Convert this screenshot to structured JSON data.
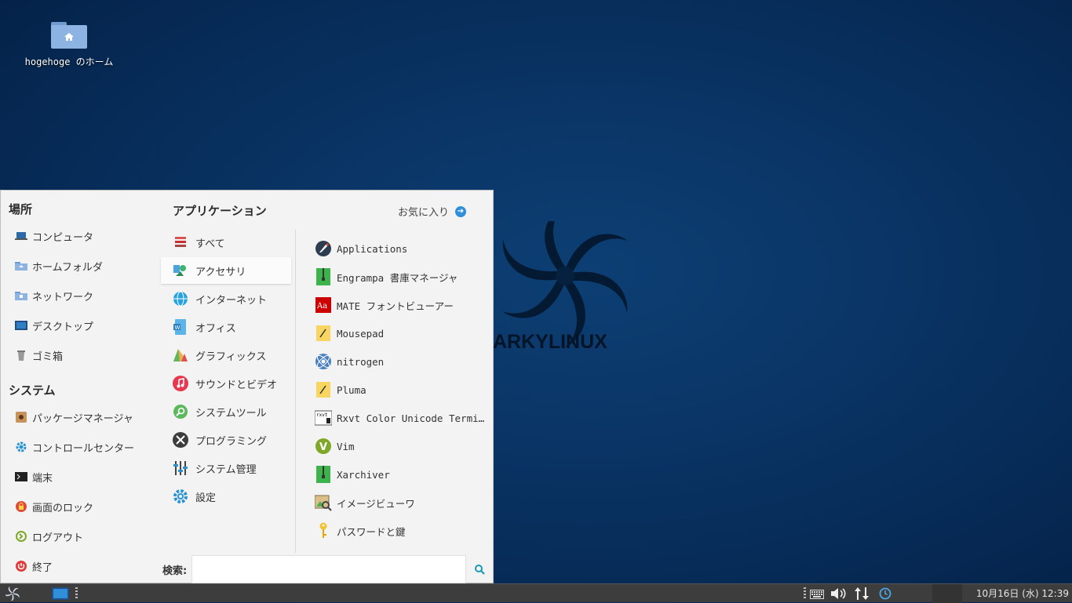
{
  "desktop": {
    "home_icon_label": "hogehoge のホーム",
    "logo_text": "ARKYLINUX"
  },
  "menu": {
    "places_title": "場所",
    "places": [
      {
        "label": "コンピュータ",
        "icon": "computer-icon"
      },
      {
        "label": "ホームフォルダ",
        "icon": "home-folder-icon"
      },
      {
        "label": "ネットワーク",
        "icon": "network-folder-icon"
      },
      {
        "label": "デスクトップ",
        "icon": "desktop-icon"
      },
      {
        "label": "ゴミ箱",
        "icon": "trash-icon"
      }
    ],
    "system_title": "システム",
    "system": [
      {
        "label": "パッケージマネージャ",
        "icon": "package-icon"
      },
      {
        "label": "コントロールセンター",
        "icon": "gear-icon"
      },
      {
        "label": "端末",
        "icon": "terminal-icon"
      },
      {
        "label": "画面のロック",
        "icon": "lock-icon"
      },
      {
        "label": "ログアウト",
        "icon": "logout-icon"
      },
      {
        "label": "終了",
        "icon": "power-icon"
      }
    ],
    "apps_title": "アプリケーション",
    "favorites_label": "お気に入り",
    "categories": [
      {
        "label": "すべて",
        "icon": "all-icon"
      },
      {
        "label": "アクセサリ",
        "icon": "accessories-icon"
      },
      {
        "label": "インターネット",
        "icon": "internet-icon"
      },
      {
        "label": "オフィス",
        "icon": "office-icon"
      },
      {
        "label": "グラフィックス",
        "icon": "graphics-icon"
      },
      {
        "label": "サウンドとビデオ",
        "icon": "music-icon"
      },
      {
        "label": "システムツール",
        "icon": "system-tools-icon"
      },
      {
        "label": "プログラミング",
        "icon": "programming-icon"
      },
      {
        "label": "システム管理",
        "icon": "admin-icon"
      },
      {
        "label": "設定",
        "icon": "settings-icon"
      }
    ],
    "active_category": "アクセサリ",
    "apps": [
      {
        "label": "Applications",
        "icon": "applications-icon"
      },
      {
        "label": "Engrampa 書庫マネージャ",
        "icon": "archive-icon"
      },
      {
        "label": "MATE フォントビューアー",
        "icon": "font-icon"
      },
      {
        "label": "Mousepad",
        "icon": "text-editor-icon"
      },
      {
        "label": "nitrogen",
        "icon": "nitrogen-icon"
      },
      {
        "label": "Pluma",
        "icon": "text-editor-icon"
      },
      {
        "label": "Rxvt Color Unicode Terminal",
        "icon": "rxvt-icon"
      },
      {
        "label": "Vim",
        "icon": "vim-icon"
      },
      {
        "label": "Xarchiver",
        "icon": "archive-icon"
      },
      {
        "label": "イメージビューワ",
        "icon": "image-viewer-icon"
      },
      {
        "label": "パスワードと鍵",
        "icon": "key-icon"
      }
    ],
    "search_label": "検索:",
    "search_value": ""
  },
  "taskbar": {
    "clock": "10月16日 (水) 12:39"
  }
}
